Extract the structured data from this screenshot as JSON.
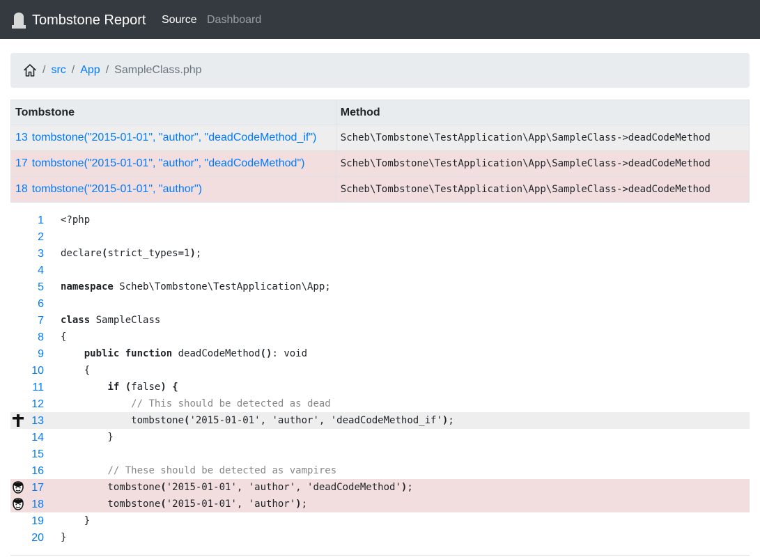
{
  "navbar": {
    "brand": "Tombstone Report",
    "links": [
      "Source",
      "Dashboard"
    ]
  },
  "breadcrumb": {
    "items": [
      "src",
      "App"
    ],
    "active": "SampleClass.php"
  },
  "table": {
    "headers": [
      "Tombstone",
      "Method"
    ],
    "rows": [
      {
        "line": "13",
        "call": "tombstone(\"2015-01-01\", \"author\", \"deadCodeMethod_if\")",
        "method": "Scheb\\Tombstone\\TestApplication\\App\\SampleClass->deadCodeMethod",
        "status": "dead"
      },
      {
        "line": "17",
        "call": "tombstone(\"2015-01-01\", \"author\", \"deadCodeMethod\")",
        "method": "Scheb\\Tombstone\\TestApplication\\App\\SampleClass->deadCodeMethod",
        "status": "vampire"
      },
      {
        "line": "18",
        "call": "tombstone(\"2015-01-01\", \"author\")",
        "method": "Scheb\\Tombstone\\TestApplication\\App\\SampleClass->deadCodeMethod",
        "status": "vampire"
      }
    ]
  },
  "code": {
    "lines": [
      {
        "n": "1",
        "parts": [
          [
            "",
            "<?php"
          ]
        ]
      },
      {
        "n": "2",
        "parts": []
      },
      {
        "n": "3",
        "parts": [
          [
            "",
            "declare"
          ],
          [
            "kw",
            "("
          ],
          [
            "",
            "strict_types=1"
          ],
          [
            "kw",
            ")"
          ],
          [
            "",
            ";"
          ]
        ]
      },
      {
        "n": "4",
        "parts": []
      },
      {
        "n": "5",
        "parts": [
          [
            "kw",
            "namespace"
          ],
          [
            "",
            " Scheb\\Tombstone\\TestApplication\\App;"
          ]
        ]
      },
      {
        "n": "6",
        "parts": []
      },
      {
        "n": "7",
        "parts": [
          [
            "kw",
            "class"
          ],
          [
            "",
            " SampleClass"
          ]
        ]
      },
      {
        "n": "8",
        "parts": [
          [
            "",
            "{"
          ]
        ]
      },
      {
        "n": "9",
        "parts": [
          [
            "",
            "    "
          ],
          [
            "kw",
            "public"
          ],
          [
            "",
            " "
          ],
          [
            "kw",
            "function"
          ],
          [
            "",
            " deadCodeMethod"
          ],
          [
            "kw",
            "()"
          ],
          [
            "",
            ": void"
          ]
        ]
      },
      {
        "n": "10",
        "parts": [
          [
            "",
            "    {"
          ]
        ]
      },
      {
        "n": "11",
        "parts": [
          [
            "",
            "        "
          ],
          [
            "kw",
            "if"
          ],
          [
            "",
            " "
          ],
          [
            "kw",
            "("
          ],
          [
            "",
            "false"
          ],
          [
            "kw",
            ")"
          ],
          [
            "",
            " "
          ],
          [
            "kw",
            "{"
          ]
        ]
      },
      {
        "n": "12",
        "parts": [
          [
            "",
            "            "
          ],
          [
            "cm",
            "// This should be detected as dead"
          ]
        ]
      },
      {
        "n": "13",
        "parts": [
          [
            "",
            "            tombstone"
          ],
          [
            "kw",
            "("
          ],
          [
            "",
            "'2015-01-01', 'author', 'deadCodeMethod_if'"
          ],
          [
            "kw",
            ")"
          ],
          [
            "",
            ";"
          ]
        ],
        "status": "dead"
      },
      {
        "n": "14",
        "parts": [
          [
            "",
            "        }"
          ]
        ]
      },
      {
        "n": "15",
        "parts": []
      },
      {
        "n": "16",
        "parts": [
          [
            "",
            "        "
          ],
          [
            "cm",
            "// These should be detected as vampires"
          ]
        ]
      },
      {
        "n": "17",
        "parts": [
          [
            "",
            "        tombstone"
          ],
          [
            "kw",
            "("
          ],
          [
            "",
            "'2015-01-01', 'author', 'deadCodeMethod'"
          ],
          [
            "kw",
            ")"
          ],
          [
            "",
            ";"
          ]
        ],
        "status": "vampire"
      },
      {
        "n": "18",
        "parts": [
          [
            "",
            "        tombstone"
          ],
          [
            "kw",
            "("
          ],
          [
            "",
            "'2015-01-01', 'author'"
          ],
          [
            "kw",
            ")"
          ],
          [
            "",
            ";"
          ]
        ],
        "status": "vampire"
      },
      {
        "n": "19",
        "parts": [
          [
            "",
            "    }"
          ]
        ]
      },
      {
        "n": "20",
        "parts": [
          [
            "",
            "}"
          ]
        ]
      }
    ]
  },
  "icons": {
    "brand": "tombstone-icon",
    "home": "home-icon",
    "dead": "cross-icon",
    "vampire": "vampire-icon"
  }
}
